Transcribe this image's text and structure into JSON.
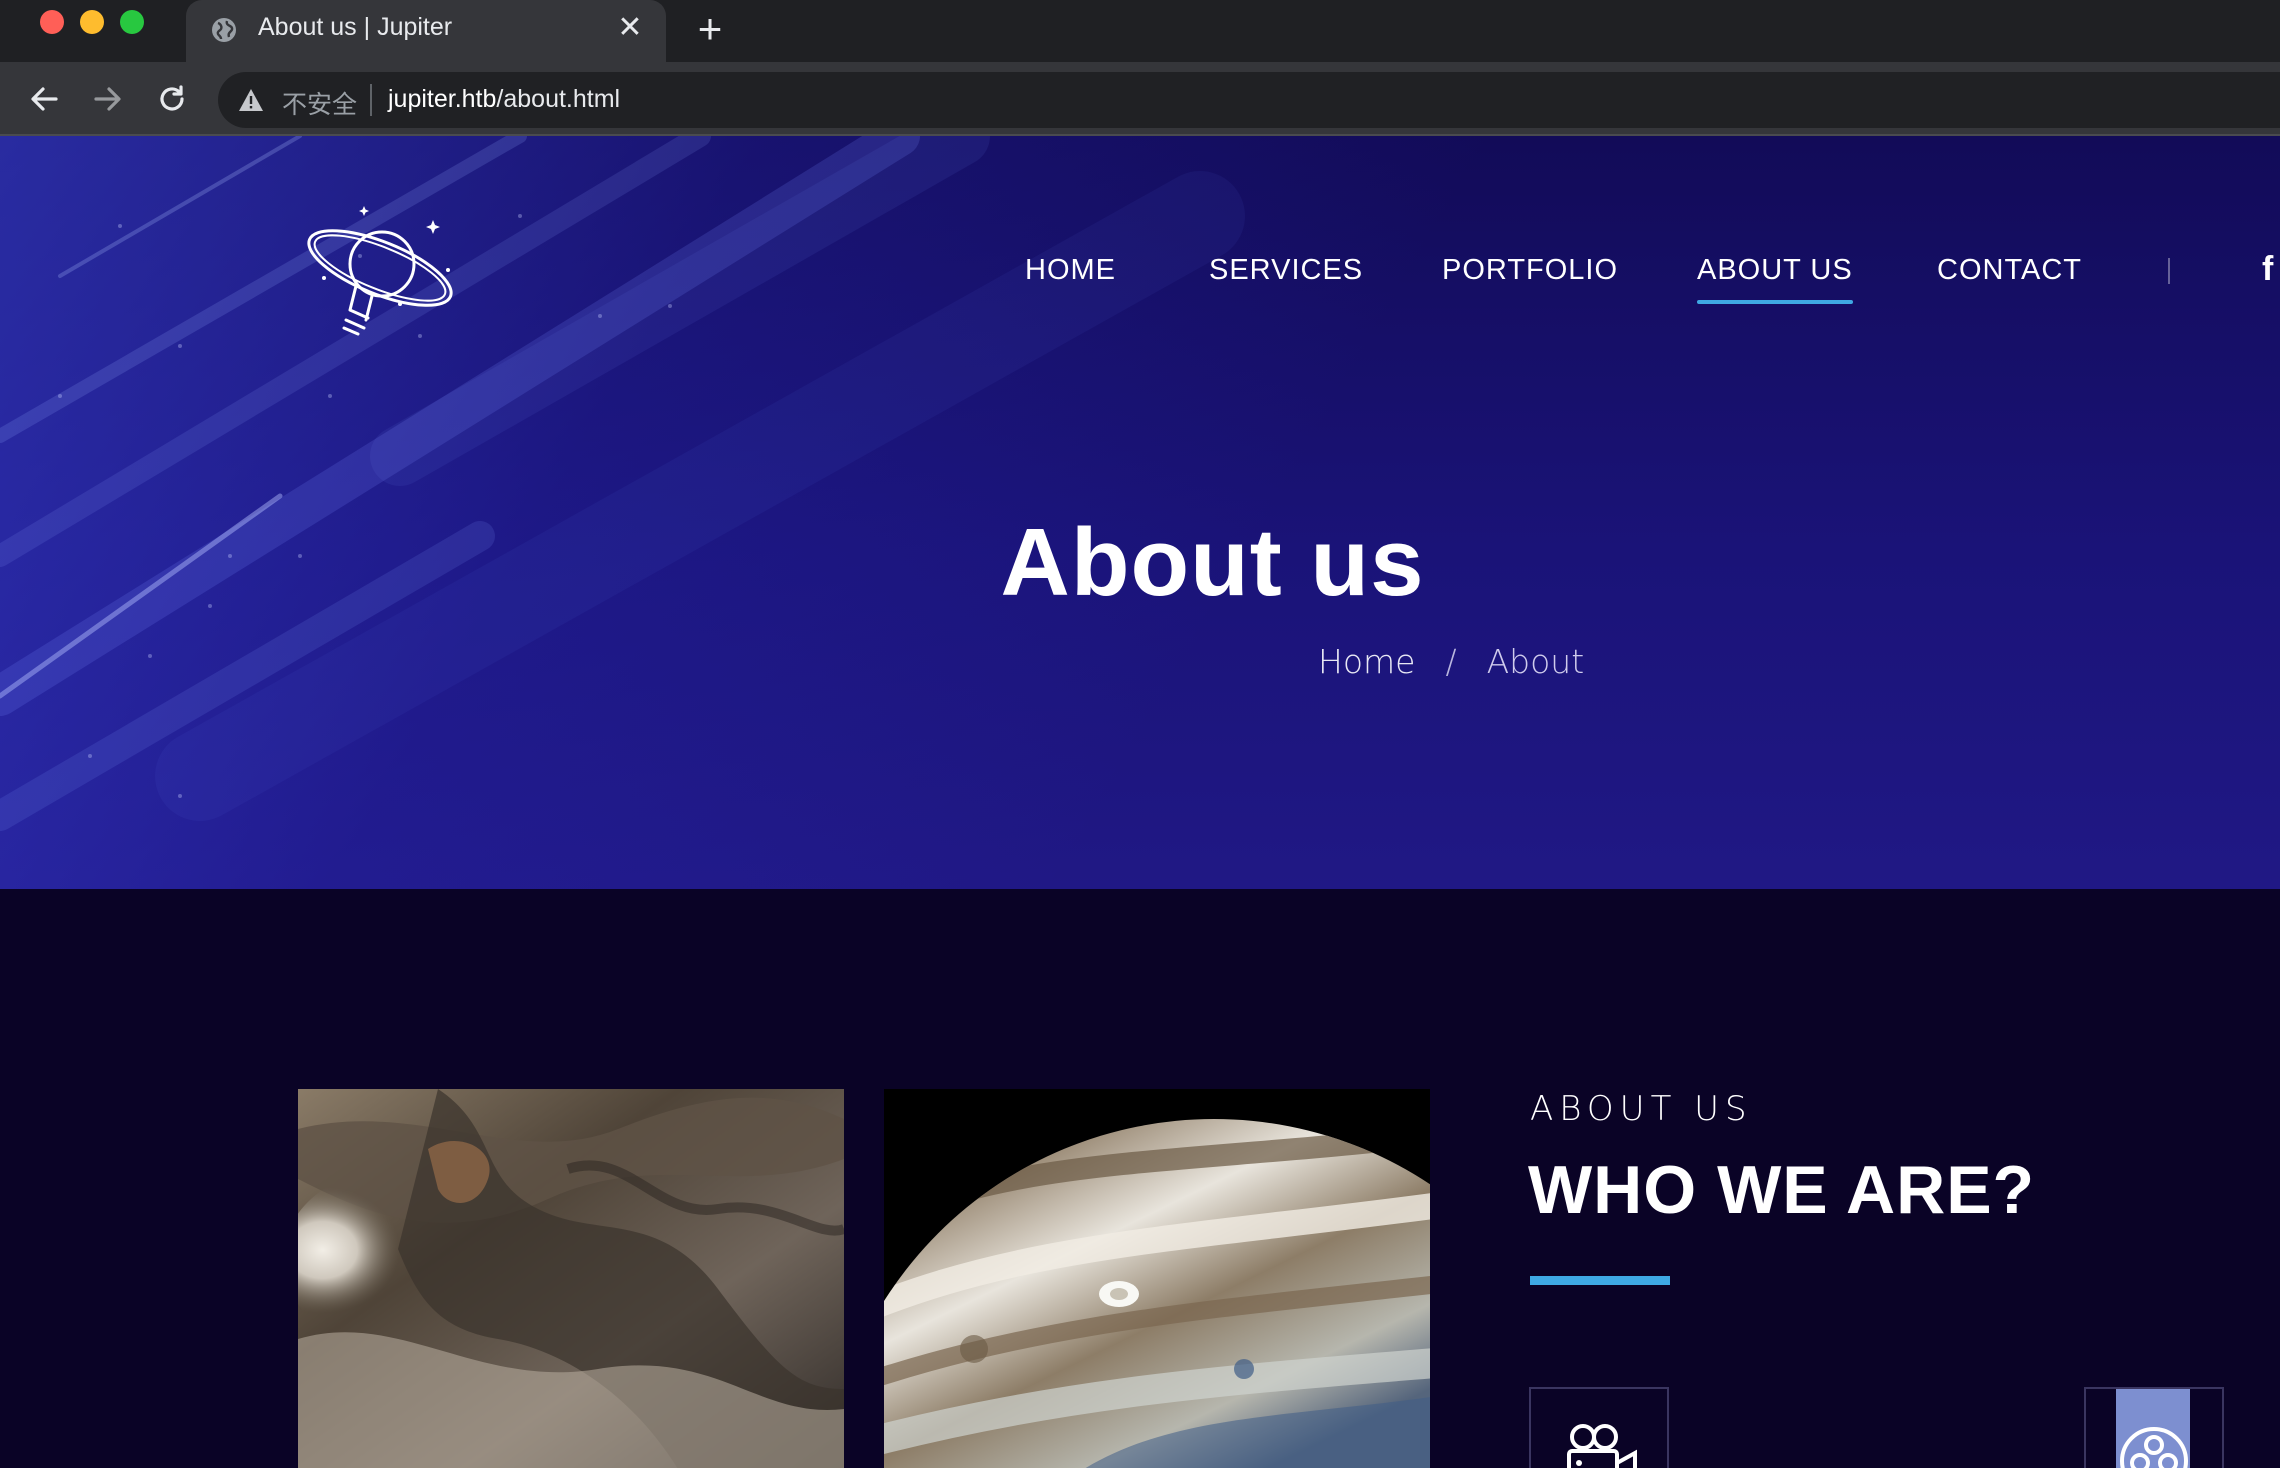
{
  "browser": {
    "tab_title": "About us | Jupiter",
    "tab_close_icon": "close-icon",
    "new_tab_icon": "plus-icon",
    "insecure_label": "不安全",
    "url_host": "jupiter.htb",
    "url_path": "/about.html"
  },
  "nav": {
    "items": [
      {
        "label": "HOME"
      },
      {
        "label": "SERVICES"
      },
      {
        "label": "PORTFOLIO"
      },
      {
        "label": "ABOUT US"
      },
      {
        "label": "CONTACT"
      }
    ],
    "active": "ABOUT US",
    "social_icon": "f"
  },
  "hero": {
    "title": "About us",
    "breadcrumb": {
      "home": "Home",
      "separator": "/",
      "current": "About"
    }
  },
  "about": {
    "eyebrow": "ABOUT US",
    "heading": "WHO WE ARE?",
    "feature_icons": [
      "video-camera-icon",
      "film-reel-icon"
    ]
  },
  "colors": {
    "accent": "#3fa9e4",
    "hero_bg": "#1a1378",
    "section_bg": "#0a0326"
  }
}
